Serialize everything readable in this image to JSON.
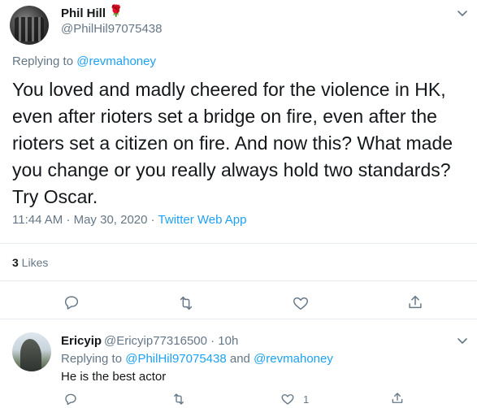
{
  "tweet": {
    "display_name": "Phil Hill",
    "emoji": "🌹",
    "handle": "@PhilHil97075438",
    "replying_prefix": "Replying to ",
    "replying_to": "@revmahoney",
    "text": "You loved and madly cheered for the violence in HK,\neven after rioters set a bridge on fire, even after the\nrioters set a citizen on fire. And now this? What made\nyou change or you really always hold two standards?\nTry Oscar.",
    "timestamp": "11:44 AM · May 30, 2020 · ",
    "source": "Twitter Web App",
    "likes_count": "3",
    "likes_label": " Likes"
  },
  "reply": {
    "display_name": "Ericyip",
    "handle_time": "@Ericyip77316500 · 10h",
    "replying_prefix": "Replying to ",
    "replying_to_1": "@PhilHil97075438",
    "replying_and": " and ",
    "replying_to_2": "@revmahoney",
    "text": "He is the best actor",
    "likes_count": "1"
  },
  "icons": {
    "reply": "speech-bubble-icon",
    "retweet": "retweet-icon",
    "like": "heart-icon",
    "share": "share-icon",
    "more": "chevron-down-icon"
  },
  "colors": {
    "link": "#1da1f2",
    "secondary_text": "#657786",
    "divider": "#e6ecf0"
  }
}
